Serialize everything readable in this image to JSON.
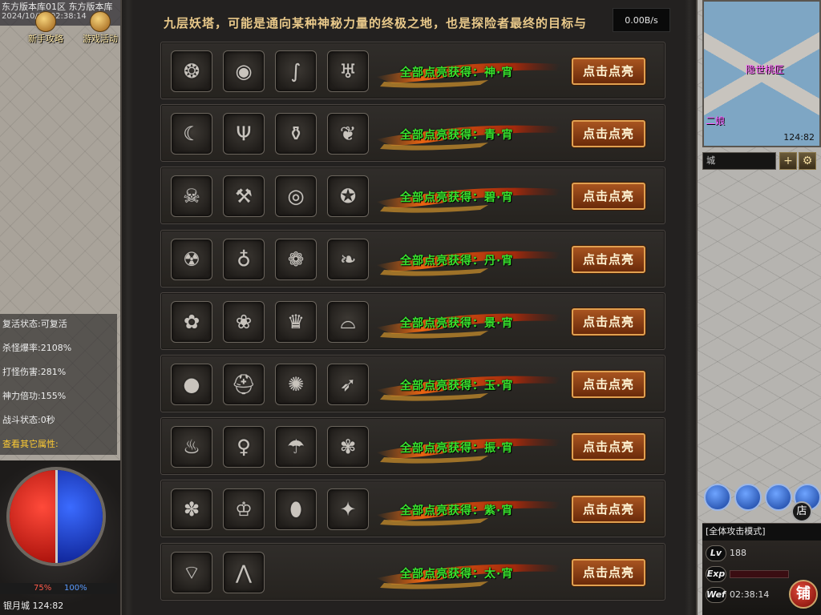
{
  "hud": {
    "server_line": "东方版本库01区 东方版本库",
    "datetime": "2024/10/17 02:38:14",
    "top_buttons": [
      "新手攻略",
      "游戏活动"
    ],
    "stats": [
      {
        "label": "复活状态:",
        "value": "可复活"
      },
      {
        "label": "杀怪爆率:",
        "value": "2108%"
      },
      {
        "label": "打怪伤害:",
        "value": "281%"
      },
      {
        "label": "神力倍功:",
        "value": "155%"
      },
      {
        "label": "战斗状态:",
        "value": "0秒"
      }
    ],
    "more_attrs": "查看其它属性:",
    "hp_percent": "75%",
    "mp_percent": "100%",
    "map_location": "银月城 124:82"
  },
  "minimap": {
    "labels": [
      "隐世桃匠",
      "二娘"
    ],
    "coord": "124:82",
    "chat_placeholder": "城",
    "add_label": "+",
    "settings_label": "⚙"
  },
  "right_panel": {
    "shop_small": "店",
    "attack_mode": "[全体攻击模式]",
    "level_tag": "Lv",
    "level_value": "188",
    "exp_tag": "Exp",
    "wef_tag": "Wef",
    "time": "02:38:14",
    "shop_big": "铺"
  },
  "dialog": {
    "header": "九层妖塔，可能是通向某种神秘力量的终极之地，也是探险者最终的目标与",
    "netspeed": "0.00B/s",
    "button_label": "点击点亮",
    "rows": [
      {
        "reward": "全部点亮获得：神·宵",
        "items": [
          "ring-icon",
          "shell-icon",
          "hook-icon",
          "lantern-icon"
        ]
      },
      {
        "reward": "全部点亮获得：青·宵",
        "items": [
          "horn-icon",
          "trident-icon",
          "jar-icon",
          "dragon-icon"
        ]
      },
      {
        "reward": "全部点亮获得：碧·宵",
        "items": [
          "mask-icon",
          "axe-icon",
          "mirror-icon",
          "orb-icon"
        ]
      },
      {
        "reward": "全部点亮获得：丹·宵",
        "items": [
          "skull-icon",
          "gourd-icon",
          "compass-icon",
          "wing-icon"
        ]
      },
      {
        "reward": "全部点亮获得：景·宵",
        "items": [
          "lotus-icon",
          "seed-icon",
          "flame-crown-icon",
          "shoe-icon"
        ]
      },
      {
        "reward": "全部点亮获得：玉·宵",
        "items": [
          "stone-icon",
          "helm-icon",
          "spider-icon",
          "feather-icon"
        ]
      },
      {
        "reward": "全部点亮获得：振·宵",
        "items": [
          "fire-icon",
          "calabash-icon",
          "umbrella-icon",
          "swirl-icon"
        ]
      },
      {
        "reward": "全部点亮获得：紫·宵",
        "items": [
          "flower-icon",
          "crown-icon",
          "egg-icon",
          "star-icon"
        ]
      },
      {
        "reward": "全部点亮获得：太·宵",
        "items": [
          "fan-icon",
          "crane-icon"
        ]
      }
    ]
  }
}
